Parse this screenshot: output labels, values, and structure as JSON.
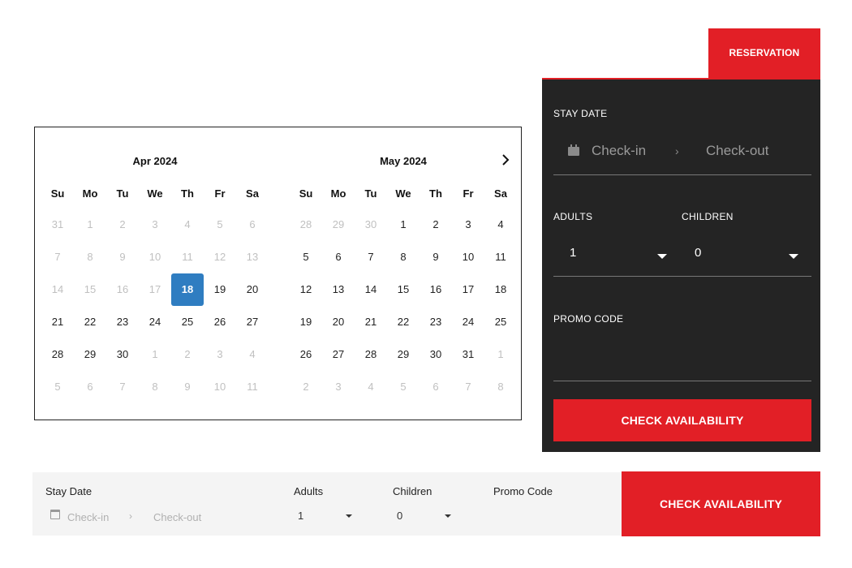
{
  "calendar": {
    "next_icon": "chevron-right-icon",
    "selected_color": "#2f7dc1",
    "months": [
      {
        "title": "Apr 2024",
        "weekdays": [
          "Su",
          "Mo",
          "Tu",
          "We",
          "Th",
          "Fr",
          "Sa"
        ],
        "weeks": [
          [
            {
              "d": "31",
              "m": true
            },
            {
              "d": "1",
              "m": true
            },
            {
              "d": "2",
              "m": true
            },
            {
              "d": "3",
              "m": true
            },
            {
              "d": "4",
              "m": true
            },
            {
              "d": "5",
              "m": true
            },
            {
              "d": "6",
              "m": true
            }
          ],
          [
            {
              "d": "7",
              "m": true
            },
            {
              "d": "8",
              "m": true
            },
            {
              "d": "9",
              "m": true
            },
            {
              "d": "10",
              "m": true
            },
            {
              "d": "11",
              "m": true
            },
            {
              "d": "12",
              "m": true
            },
            {
              "d": "13",
              "m": true
            }
          ],
          [
            {
              "d": "14",
              "m": true
            },
            {
              "d": "15",
              "m": true
            },
            {
              "d": "16",
              "m": true
            },
            {
              "d": "17",
              "m": true
            },
            {
              "d": "18",
              "s": true
            },
            {
              "d": "19"
            },
            {
              "d": "20"
            }
          ],
          [
            {
              "d": "21"
            },
            {
              "d": "22"
            },
            {
              "d": "23"
            },
            {
              "d": "24"
            },
            {
              "d": "25"
            },
            {
              "d": "26"
            },
            {
              "d": "27"
            }
          ],
          [
            {
              "d": "28"
            },
            {
              "d": "29"
            },
            {
              "d": "30"
            },
            {
              "d": "1",
              "m": true
            },
            {
              "d": "2",
              "m": true
            },
            {
              "d": "3",
              "m": true
            },
            {
              "d": "4",
              "m": true
            }
          ],
          [
            {
              "d": "5",
              "m": true
            },
            {
              "d": "6",
              "m": true
            },
            {
              "d": "7",
              "m": true
            },
            {
              "d": "8",
              "m": true
            },
            {
              "d": "9",
              "m": true
            },
            {
              "d": "10",
              "m": true
            },
            {
              "d": "11",
              "m": true
            }
          ]
        ]
      },
      {
        "title": "May 2024",
        "weekdays": [
          "Su",
          "Mo",
          "Tu",
          "We",
          "Th",
          "Fr",
          "Sa"
        ],
        "weeks": [
          [
            {
              "d": "28",
              "m": true
            },
            {
              "d": "29",
              "m": true
            },
            {
              "d": "30",
              "m": true
            },
            {
              "d": "1"
            },
            {
              "d": "2"
            },
            {
              "d": "3"
            },
            {
              "d": "4"
            }
          ],
          [
            {
              "d": "5"
            },
            {
              "d": "6"
            },
            {
              "d": "7"
            },
            {
              "d": "8"
            },
            {
              "d": "9"
            },
            {
              "d": "10"
            },
            {
              "d": "11"
            }
          ],
          [
            {
              "d": "12"
            },
            {
              "d": "13"
            },
            {
              "d": "14"
            },
            {
              "d": "15"
            },
            {
              "d": "16"
            },
            {
              "d": "17"
            },
            {
              "d": "18"
            }
          ],
          [
            {
              "d": "19"
            },
            {
              "d": "20"
            },
            {
              "d": "21"
            },
            {
              "d": "22"
            },
            {
              "d": "23"
            },
            {
              "d": "24"
            },
            {
              "d": "25"
            }
          ],
          [
            {
              "d": "26"
            },
            {
              "d": "27"
            },
            {
              "d": "28"
            },
            {
              "d": "29"
            },
            {
              "d": "30"
            },
            {
              "d": "31"
            },
            {
              "d": "1",
              "m": true
            }
          ],
          [
            {
              "d": "2",
              "m": true
            },
            {
              "d": "3",
              "m": true
            },
            {
              "d": "4",
              "m": true
            },
            {
              "d": "5",
              "m": true
            },
            {
              "d": "6",
              "m": true
            },
            {
              "d": "7",
              "m": true
            },
            {
              "d": "8",
              "m": true
            }
          ]
        ]
      }
    ]
  },
  "reservation": {
    "tab_label": "RESERVATION",
    "accent_color": "#e21f26",
    "panel_color": "#242424",
    "stay_date_label": "STAY DATE",
    "calendar_icon": "calendar-icon",
    "checkin_placeholder": "Check-in",
    "separator": "›",
    "checkout_placeholder": "Check-out",
    "adults_label": "ADULTS",
    "adults_value": "1",
    "children_label": "CHILDREN",
    "children_value": "0",
    "promo_label": "PROMO CODE",
    "cta_label": "CHECK AVAILABILITY"
  },
  "bar": {
    "stay_date_label": "Stay Date",
    "calendar_icon": "calendar-icon",
    "checkin_placeholder": "Check-in",
    "separator": "›",
    "checkout_placeholder": "Check-out",
    "adults_label": "Adults",
    "adults_value": "1",
    "children_label": "Children",
    "children_value": "0",
    "promo_label": "Promo Code",
    "cta_label": "CHECK AVAILABILITY"
  }
}
